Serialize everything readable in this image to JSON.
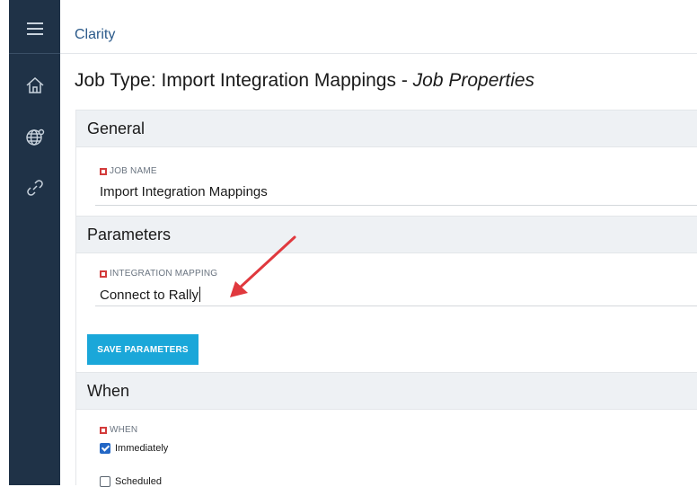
{
  "app": {
    "name": "Clarity"
  },
  "sidebar": {
    "items": [
      {
        "icon": "menu-icon"
      },
      {
        "icon": "home-icon"
      },
      {
        "icon": "globe-icon"
      },
      {
        "icon": "link-icon"
      }
    ]
  },
  "page": {
    "title_prefix": "Job Type: Import Integration Mappings - ",
    "title_suffix": "Job Properties"
  },
  "sections": {
    "general": {
      "title": "General",
      "job_name_label": "JOB NAME",
      "job_name_value": "Import Integration Mappings"
    },
    "parameters": {
      "title": "Parameters",
      "mapping_label": "INTEGRATION MAPPING",
      "mapping_value": "Connect to Rally",
      "save_label": "SAVE PARAMETERS"
    },
    "when": {
      "title": "When",
      "when_label": "WHEN",
      "options": [
        {
          "label": "Immediately",
          "checked": true
        },
        {
          "label": "Scheduled",
          "checked": false
        }
      ]
    }
  },
  "colors": {
    "sidebar": "#1f3247",
    "accent": "#1aa7d9",
    "required": "#d33b3b",
    "annotation_arrow": "#e0393e"
  }
}
